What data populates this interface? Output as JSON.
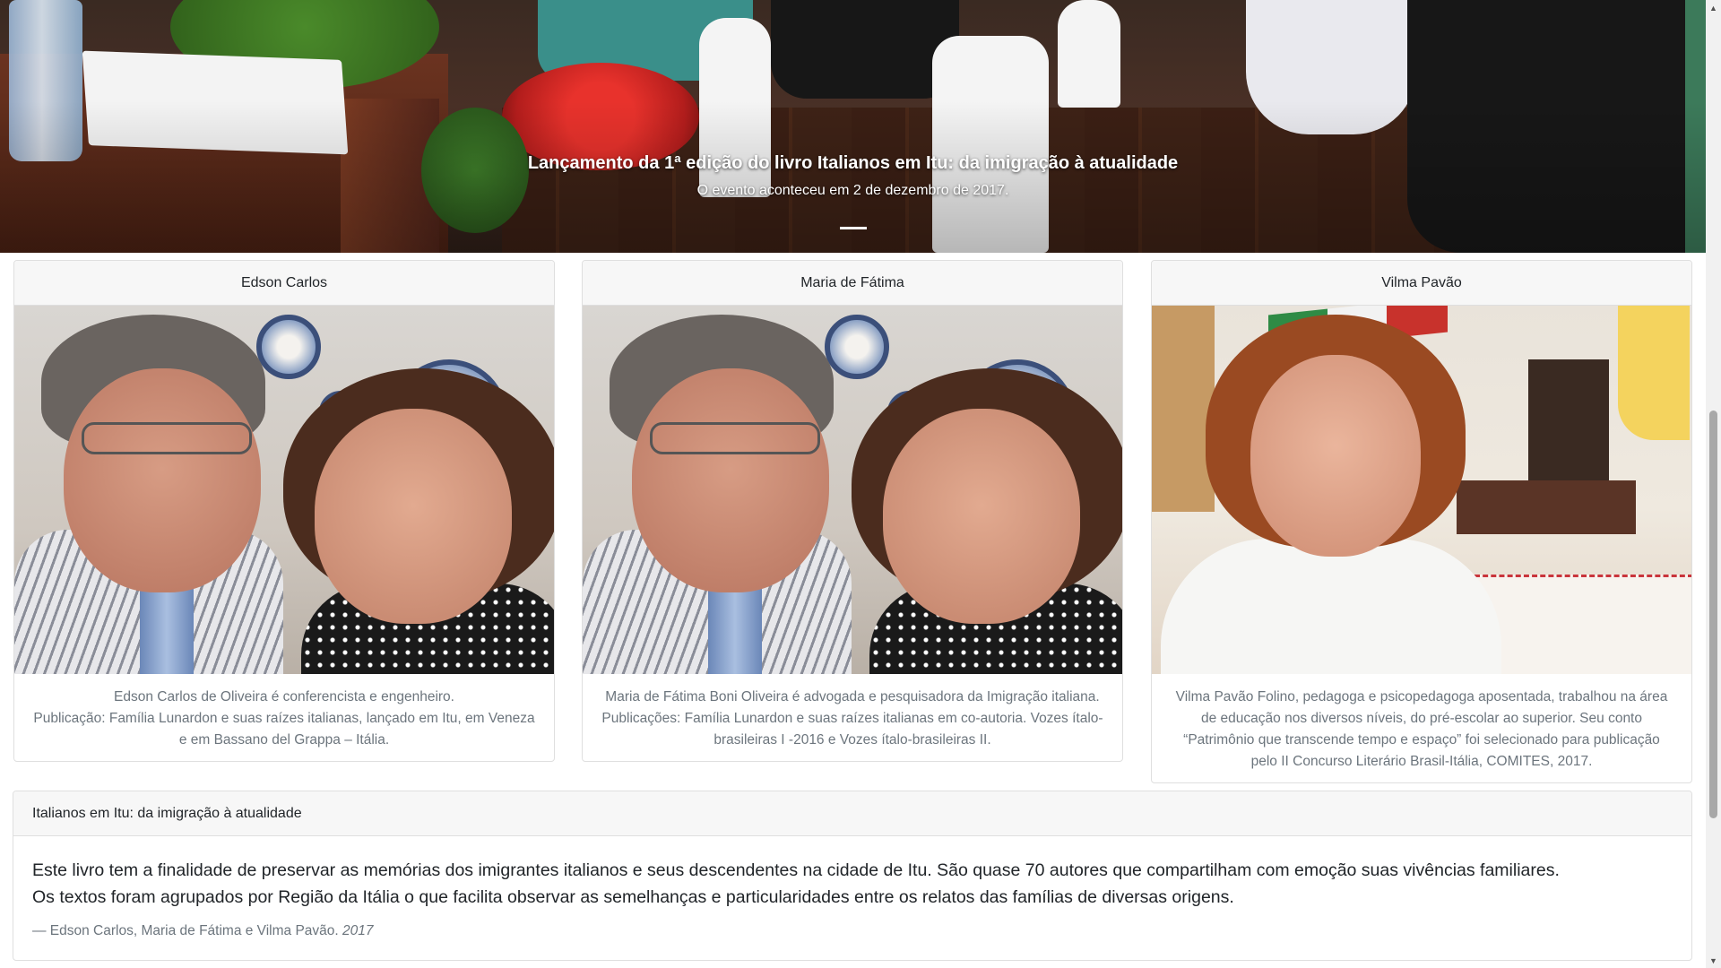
{
  "carousel": {
    "title": "Lançamento da 1ª edição do livro Italianos em Itu: da imigração à atualidade",
    "subtitle": "O evento aconteceu em 2 de dezembro de 2017.",
    "slides_count": 1,
    "active_slide": 1
  },
  "authors": [
    {
      "name": "Edson Carlos",
      "bio_lines": [
        "Edson Carlos de Oliveira é conferencista e engenheiro.",
        "Publicação: Família Lunardon e suas raízes italianas, lançado em Itu, em Veneza",
        "e em Bassano del Grappa – Itália."
      ]
    },
    {
      "name": "Maria de Fátima",
      "bio_lines": [
        "Maria de Fátima Boni Oliveira é advogada e pesquisadora da Imigração italiana.",
        "Publicações: Família Lunardon e suas raízes italianas em co-autoria. Vozes ítalo-",
        "brasileiras I -2016 e Vozes ítalo-brasileiras II."
      ]
    },
    {
      "name": "Vilma Pavão",
      "bio_lines": [
        "Vilma Pavão Folino, pedagoga e psicopedagoga aposentada, trabalhou na área",
        "de educação nos diversos níveis, do pré-escolar ao superior. Seu conto",
        "“Patrimônio que transcende tempo e espaço” foi selecionado para publicação",
        "pelo II Concurso Literário Brasil-Itália, COMITES, 2017."
      ]
    }
  ],
  "book": {
    "header": "Italianos em Itu: da imigração à atualidade",
    "quote_lines": [
      "Este livro tem a finalidade de preservar as memórias dos imigrantes italianos e seus descendentes na cidade de Itu. São quase 70 autores que compartilham com emoção suas vivências familiares.",
      "Os textos foram agrupados por Região da Itália o que facilita observar as semelhanças e particularidades entre os relatos das famílias de diversas origens."
    ],
    "attribution": "— Edson Carlos, Maria de Fátima e Vilma Pavão.",
    "year": "2017"
  },
  "icons": {
    "scroll_up": "scroll-up-arrow-icon",
    "scroll_down": "scroll-down-arrow-icon"
  },
  "colors": {
    "card_header_bg": "#f7f7f7",
    "border": "#dfdfdf",
    "muted_text": "#6c757d"
  }
}
